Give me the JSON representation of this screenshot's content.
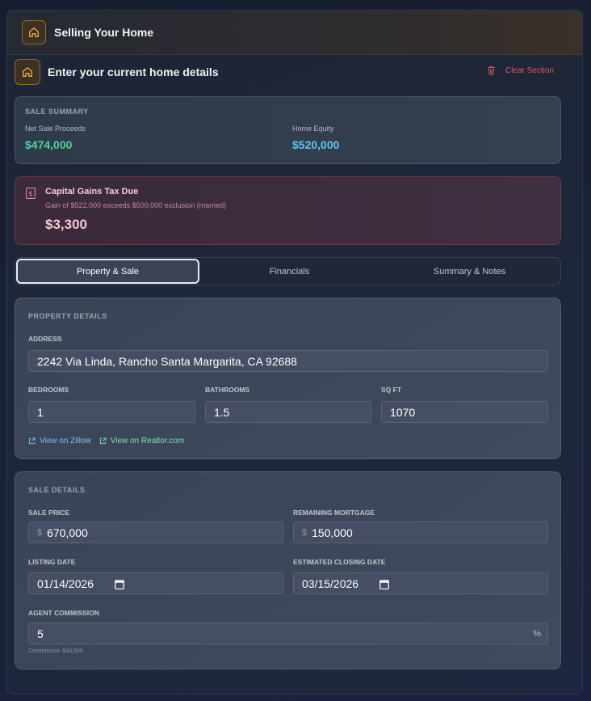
{
  "header": {
    "title": "Selling Your Home"
  },
  "section": {
    "title": "Enter your current home details",
    "clear_label": "Clear Section"
  },
  "summary": {
    "label": "SALE SUMMARY",
    "net_label": "Net Sale Proceeds",
    "net_value": "$474,000",
    "equity_label": "Home Equity",
    "equity_value": "$520,000"
  },
  "tax": {
    "title": "Capital Gains Tax Due",
    "subtitle": "Gain of $522,000 exceeds $500,000 exclusion (married)",
    "amount": "$3,300"
  },
  "tabs": [
    {
      "label": "Property & Sale",
      "active": true
    },
    {
      "label": "Financials",
      "active": false
    },
    {
      "label": "Summary & Notes",
      "active": false
    }
  ],
  "property": {
    "label": "PROPERTY DETAILS",
    "address_label": "ADDRESS",
    "address": "2242 Via Linda, Rancho Santa Margarita, CA 92688",
    "bedrooms_label": "BEDROOMS",
    "bedrooms": "1",
    "bathrooms_label": "BATHROOMS",
    "bathrooms": "1.5",
    "sqft_label": "SQ FT",
    "sqft": "1070",
    "zillow_label": "View on Zillow",
    "realtor_label": "View on Realtor.com"
  },
  "sale": {
    "label": "SALE DETAILS",
    "price_label": "SALE PRICE",
    "price_prefix": "$",
    "price": "670,000",
    "mortgage_label": "REMAINING MORTGAGE",
    "mortgage_prefix": "$",
    "mortgage": "150,000",
    "listing_label": "LISTING DATE",
    "listing_date": "01/14/2026",
    "closing_label": "ESTIMATED CLOSING DATE",
    "closing_date": "03/15/2026",
    "commission_label": "AGENT COMMISSION",
    "commission": "5",
    "commission_suffix": "%",
    "commission_hint": "Commission: $33,500"
  },
  "colors": {
    "accent_gold": "#d9a441",
    "green": "#4fd39a",
    "blue": "#5bc6f2",
    "danger": "#d65c5c"
  }
}
